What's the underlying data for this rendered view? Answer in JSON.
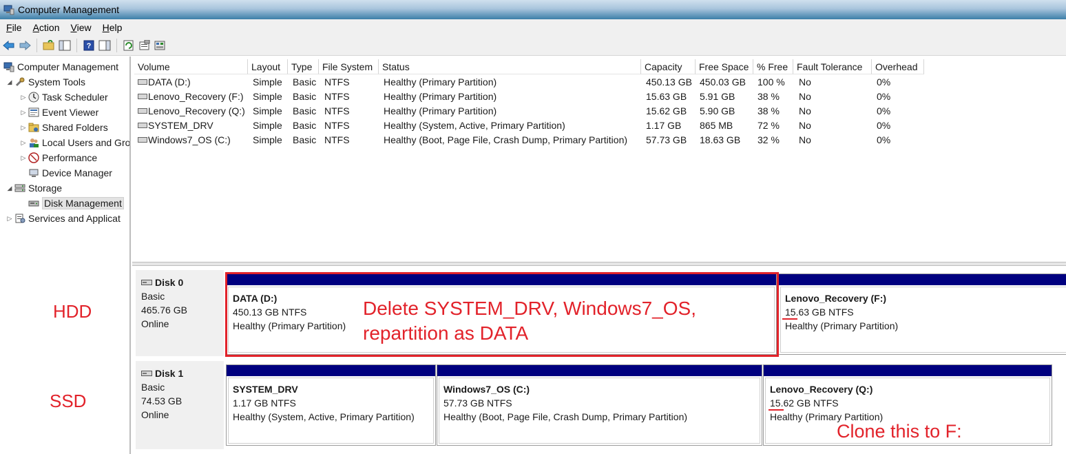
{
  "window": {
    "title": "Computer Management"
  },
  "menu": [
    "File",
    "Action",
    "View",
    "Help"
  ],
  "toolbar": {
    "icons": [
      "back-arrow-icon",
      "forward-arrow-icon",
      "up-folder-icon",
      "show-hide-tree-icon",
      "help-icon",
      "action-pane-icon",
      "refresh-icon",
      "properties-icon",
      "disk-properties-icon"
    ]
  },
  "tree": [
    {
      "label": "Computer Management",
      "level": 0,
      "arrow": "",
      "icon": "computer-icon"
    },
    {
      "label": "System Tools",
      "level": 1,
      "arrow": "◢",
      "icon": "tools-icon"
    },
    {
      "label": "Task Scheduler",
      "level": 2,
      "arrow": "▷",
      "icon": "clock-icon"
    },
    {
      "label": "Event Viewer",
      "level": 2,
      "arrow": "▷",
      "icon": "event-viewer-icon"
    },
    {
      "label": "Shared Folders",
      "level": 2,
      "arrow": "▷",
      "icon": "shared-folder-icon"
    },
    {
      "label": "Local Users and Gro",
      "level": 2,
      "arrow": "▷",
      "icon": "users-icon"
    },
    {
      "label": "Performance",
      "level": 2,
      "arrow": "▷",
      "icon": "performance-icon"
    },
    {
      "label": "Device Manager",
      "level": 2,
      "arrow": "",
      "icon": "device-manager-icon"
    },
    {
      "label": "Storage",
      "level": 1,
      "arrow": "◢",
      "icon": "storage-icon"
    },
    {
      "label": "Disk Management",
      "level": 2,
      "arrow": "",
      "icon": "disk-management-icon",
      "selected": true
    },
    {
      "label": "Services and Applicat",
      "level": 1,
      "arrow": "▷",
      "icon": "services-icon"
    }
  ],
  "volume_list": {
    "columns": [
      "Volume",
      "Layout",
      "Type",
      "File System",
      "Status",
      "Capacity",
      "Free Space",
      "% Free",
      "Fault Tolerance",
      "Overhead"
    ],
    "rows": [
      [
        "DATA (D:)",
        "Simple",
        "Basic",
        "NTFS",
        "Healthy (Primary Partition)",
        "450.13 GB",
        "450.03 GB",
        "100 %",
        "No",
        "0%"
      ],
      [
        "Lenovo_Recovery (F:)",
        "Simple",
        "Basic",
        "NTFS",
        "Healthy (Primary Partition)",
        "15.63 GB",
        "5.91 GB",
        "38 %",
        "No",
        "0%"
      ],
      [
        "Lenovo_Recovery (Q:)",
        "Simple",
        "Basic",
        "NTFS",
        "Healthy (Primary Partition)",
        "15.62 GB",
        "5.90 GB",
        "38 %",
        "No",
        "0%"
      ],
      [
        "SYSTEM_DRV",
        "Simple",
        "Basic",
        "NTFS",
        "Healthy (System, Active, Primary Partition)",
        "1.17 GB",
        "865 MB",
        "72 %",
        "No",
        "0%"
      ],
      [
        "Windows7_OS (C:)",
        "Simple",
        "Basic",
        "NTFS",
        "Healthy (Boot, Page File, Crash Dump, Primary Partition)",
        "57.73 GB",
        "18.63 GB",
        "32 %",
        "No",
        "0%"
      ]
    ]
  },
  "disks": [
    {
      "name": "Disk 0",
      "type": "Basic",
      "size": "465.76 GB",
      "state": "Online",
      "partitions": [
        {
          "name": "DATA  (D:)",
          "size_fs": "450.13 GB NTFS",
          "status": "Healthy (Primary Partition)"
        },
        {
          "name": "Lenovo_Recovery  (F:)",
          "size_fs": "15.63 GB NTFS",
          "status": "Healthy (Primary Partition)"
        }
      ]
    },
    {
      "name": "Disk 1",
      "type": "Basic",
      "size": "74.53 GB",
      "state": "Online",
      "partitions": [
        {
          "name": "SYSTEM_DRV",
          "size_fs": "1.17 GB NTFS",
          "status": "Healthy (System, Active, Primary Partition)"
        },
        {
          "name": "Windows7_OS  (C:)",
          "size_fs": "57.73 GB NTFS",
          "status": "Healthy (Boot, Page File, Crash Dump, Primary Partition)"
        },
        {
          "name": "Lenovo_Recovery  (Q:)",
          "size_fs": "15.62 GB NTFS",
          "status": "Healthy (Primary Partition)"
        }
      ]
    }
  ],
  "annotations": {
    "hdd": "HDD",
    "ssd": "SSD",
    "delete_line1": "Delete SYSTEM_DRV, Windows7_OS,",
    "delete_line2": "repartition as DATA",
    "clone": "Clone this to F:"
  },
  "colors": {
    "partition_bar": "#00007f",
    "annotation": "#e2222a"
  }
}
